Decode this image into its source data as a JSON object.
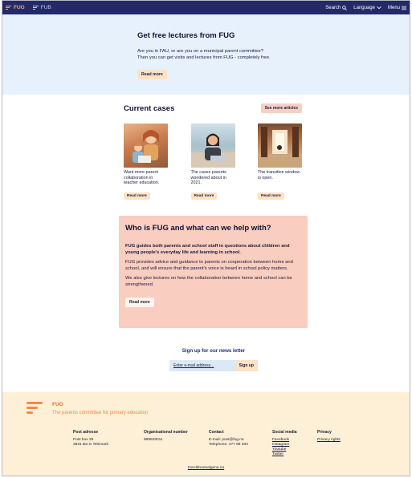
{
  "nav": {
    "brand": "FUG",
    "brand_alt": "FUB",
    "search": "Search",
    "language": "Language",
    "menu": "Menu"
  },
  "hero": {
    "title": "Get free lectures from FUG",
    "line1": "Are you in FAU, or are you on a municipal parent committee?",
    "line2": "Then you can get visits and lectures from FUG - completely free.",
    "button": "Read more"
  },
  "cases": {
    "title": "Current cases",
    "more_button": "See more articles",
    "items": [
      {
        "text": "Want more parent collaboration in teacher education.",
        "button": "Read more"
      },
      {
        "text": "The cases parents wondered about in 2021.",
        "button": "Read more"
      },
      {
        "text": "The transition window is open.",
        "button": "Read more"
      }
    ]
  },
  "who": {
    "title": "Who is FUG and what can we help with?",
    "lead": "FUG guides both parents and school staff in questions about children and young people's everyday life and learning in school.",
    "p2": "FUG provides advice and guidance to parents on cooperation between home and school, and will ensure that the parent's voice is heard in school policy matters.",
    "p3": "We also give lectures on how the collaboration between home and school can be strengthened.",
    "button": "Read more"
  },
  "newsletter": {
    "title": "Sign up for our news letter",
    "placeholder": "Enter e-mail address...",
    "button": "Sign up"
  },
  "footer": {
    "logo_name": "FUG",
    "tagline": "The parents committee for primary education",
    "post_title": "Post adresse",
    "post_line1": "Post box 29",
    "post_line2": "3831 Bø in Telemark",
    "org_title": "Organisational number",
    "org_number": "989628011",
    "contact_title": "Contact",
    "contact_email": "E-mail: post@fug.no",
    "contact_phone": "Telephone: 477 99 300",
    "social_title": "Social media",
    "social": [
      "Facebook",
      "Instagram",
      "Youtube",
      "Twitter"
    ],
    "privacy_title": "Privacy",
    "privacy_link": "Privacy rights",
    "bottom_link": "Foreldreutvalgene.no"
  }
}
